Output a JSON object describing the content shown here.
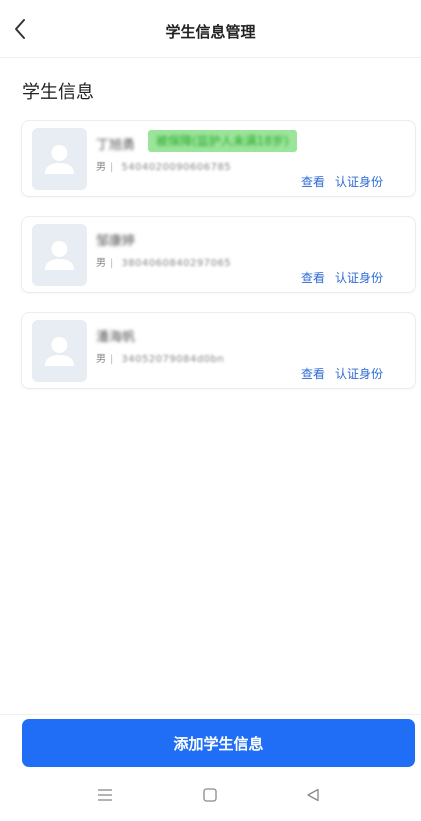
{
  "header": {
    "title": "学生信息管理",
    "back_icon": "chevron-left-icon"
  },
  "section_title": "学生信息",
  "students": [
    {
      "name": "丁旭勇",
      "tag": "被保障(监护人未满18岁)",
      "gender": "男",
      "separator": "|",
      "id_number": "5404020090606785",
      "view_label": "查看",
      "verify_label": "认证身份"
    },
    {
      "name": "邹康婷",
      "gender": "男",
      "separator": "|",
      "id_number": "3804060840297065",
      "view_label": "查看",
      "verify_label": "认证身份"
    },
    {
      "name": "潘海帆",
      "gender": "男",
      "separator": "|",
      "id_number": "34052079084d0bn",
      "view_label": "查看",
      "verify_label": "认证身份"
    }
  ],
  "add_button": "添加学生信息",
  "nav": {
    "menu_icon": "menu-icon",
    "home_icon": "home-square-icon",
    "back_icon": "back-triangle-icon"
  },
  "colors": {
    "accent": "#1f6ef5",
    "link": "#2d6bd6",
    "tag_bg": "#9be59b",
    "avatar_bg": "#e8ecf3"
  }
}
